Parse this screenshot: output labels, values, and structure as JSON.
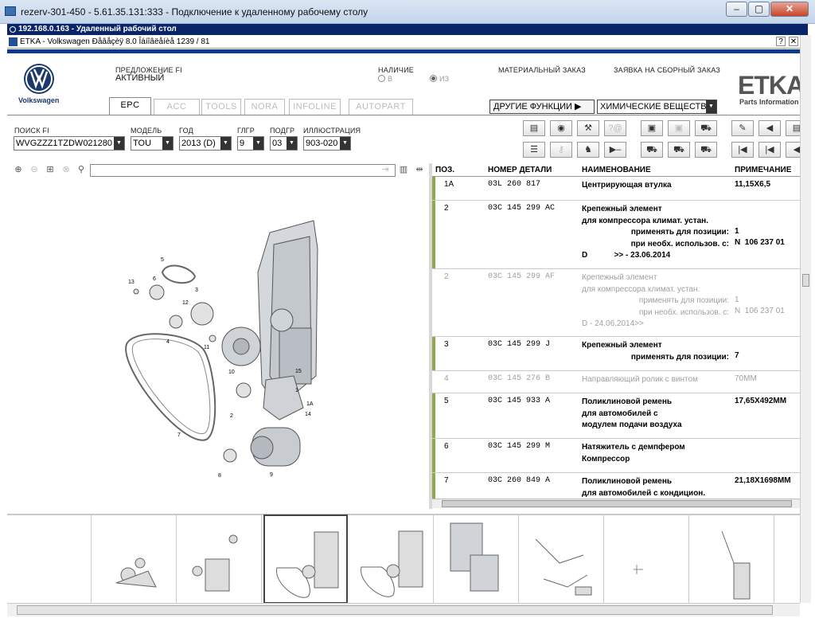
{
  "window": {
    "title": "rezerv-301-450 - 5.61.35.131:333 - Подключение к удаленному рабочему столу"
  },
  "rdp": {
    "bar": "192.168.0.163 - Удаленный рабочий стол"
  },
  "app": {
    "title": "ETKA - Volkswagen Ðåâåçèÿ 8.0 Îáíîâëåíèå 1239 / 81"
  },
  "brand": {
    "name": "Volkswagen",
    "logo": "ETKA",
    "logo_sub": "Parts Information"
  },
  "header": {
    "offer_label": "ПРЕДЛОЖЕНИЕ FI",
    "offer_value": "АКТИВНЫЙ",
    "avail_label": "НАЛИЧИЕ",
    "avail_opt1": "В",
    "avail_opt2": "ИЗ",
    "material_order": "МАТЕРИАЛЬНЫЙ ЗАКАЗ",
    "assembly_order": "ЗАЯВКА НА СБОРНЫЙ ЗАКАЗ"
  },
  "tabs": [
    {
      "label": "EPC",
      "active": true
    },
    {
      "label": "ACC",
      "active": false
    },
    {
      "label": "TOOLS",
      "active": false
    },
    {
      "label": "NORA",
      "active": false
    },
    {
      "label": "INFOLINE",
      "active": false
    },
    {
      "label": "AUTOPART",
      "active": false
    }
  ],
  "functions": {
    "other": "ДРУГИЕ ФУНКЦИИ ▶",
    "selected": "ХИМИЧЕСКИЕ ВЕЩЕСТВА"
  },
  "filters": {
    "search_label": "ПОИСК FI",
    "search_value": "WVGZZZ1TZDW021280",
    "model_label": "МОДЕЛЬ",
    "model_value": "TOU",
    "year_label": "ГОД",
    "year_value": "2013 (D)",
    "hg_label": "ГЛГР",
    "hg_value": "9",
    "ug_label": "ПОДГР",
    "ug_value": "03",
    "illus_label": "ИЛЛЮСТРАЦИЯ",
    "illus_value": "903-020"
  },
  "grid": {
    "headers": {
      "pos": "ПОЗ.",
      "part": "НОМЕР ДЕТАЛИ",
      "name": "НАИМЕНОВАНИЕ",
      "note": "ПРИМЕЧАНИЕ"
    },
    "rows": [
      {
        "pos": "1A",
        "part": "03L 260 817",
        "name": "Центрирующая втулка",
        "note": "11,15X6,5"
      },
      {
        "pos": "2",
        "part": "03C 145 299 AC",
        "name": "Крепежный элемент",
        "l2": "для компрессора климат. устан.",
        "l3": "применять для позиции:",
        "l3v": "1",
        "l4": "при необх. использов. с:",
        "l4v": "N  106 237 01",
        "l5": "D",
        "l5b": ">> - 23.06.2014"
      },
      {
        "pos": "2",
        "part": "03C 145 299 AF",
        "name": "Крепежный элемент",
        "l2": "для компрессора климат. устан.",
        "l3": "применять для позиции:",
        "l3v": "1",
        "l4": "при необх. использов. с:",
        "l4v": "N  106 237 01",
        "l5": "D - 24.06.2014>>"
      },
      {
        "pos": "3",
        "part": "03C 145 299 J",
        "name": "Крепежный элемент",
        "l2": "применять для позиции:",
        "l2v": "7"
      },
      {
        "pos": "4",
        "part": "03C 145 276 B",
        "name": "Направляющий ролик с винтом",
        "note": "70MM"
      },
      {
        "pos": "5",
        "part": "03C 145 933 A",
        "name": "Поликлиновой ремень",
        "l2": "для автомобилей с",
        "l3": "модулем подачи воздуха",
        "note": "17,65X492MM"
      },
      {
        "pos": "6",
        "part": "03C 145 299 M",
        "name": "Натяжитель с демпфером",
        "l2": "Компрессор"
      },
      {
        "pos": "7",
        "part": "03C 260 849 A",
        "name": "Поликлиновой ремень",
        "l2": "для автомобилей с кондицион.",
        "note": "21,18X1698MM"
      }
    ]
  },
  "diagram_labels": [
    "5",
    "6",
    "13",
    "3",
    "12",
    "4",
    "11",
    "10",
    "15",
    "1",
    "1A",
    "14",
    "2",
    "7",
    "8",
    "9"
  ],
  "colors": {
    "accent": "#0e3a8e",
    "row_marker": "#8fa84a"
  }
}
